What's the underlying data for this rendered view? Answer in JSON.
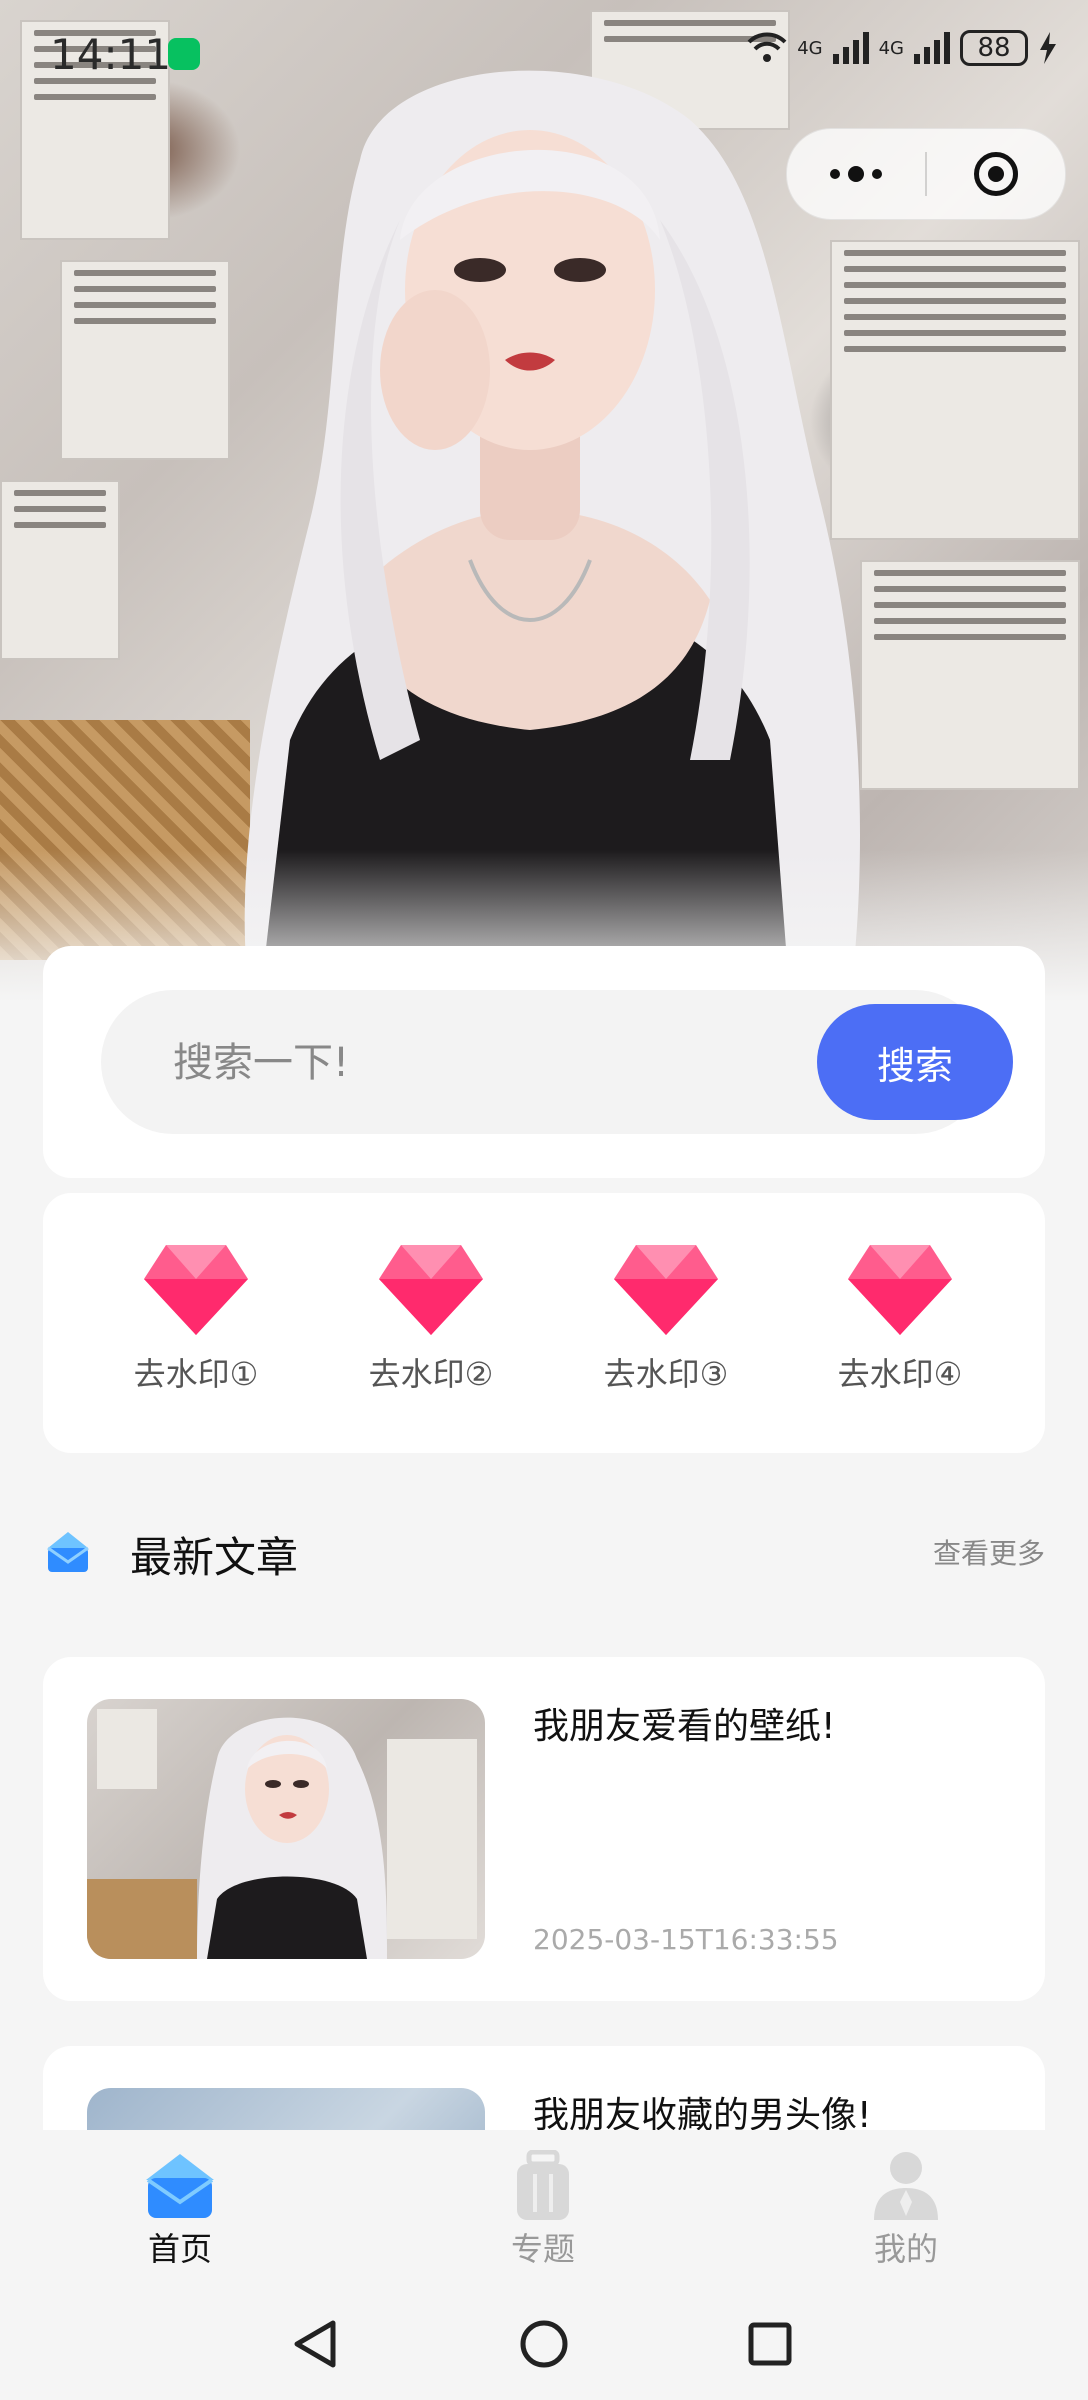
{
  "status_bar": {
    "time": "14:11",
    "network_1": "4G",
    "network_2": "4G",
    "battery": "88"
  },
  "search": {
    "placeholder": "搜索一下!",
    "button_label": "搜索"
  },
  "tools": [
    {
      "label": "去水印①",
      "icon": "diamond-icon"
    },
    {
      "label": "去水印②",
      "icon": "diamond-icon"
    },
    {
      "label": "去水印③",
      "icon": "diamond-icon"
    },
    {
      "label": "去水印④",
      "icon": "diamond-icon"
    }
  ],
  "latest": {
    "title": "最新文章",
    "more_label": "查看更多"
  },
  "articles": [
    {
      "title": "我朋友爱看的壁纸!",
      "date": "2025-03-15T16:33:55"
    },
    {
      "title": "我朋友收藏的男头像!"
    }
  ],
  "tabbar": {
    "items": [
      {
        "label": "首页",
        "icon": "home-icon",
        "active": true
      },
      {
        "label": "专题",
        "icon": "luggage-icon",
        "active": false
      },
      {
        "label": "我的",
        "icon": "user-icon",
        "active": false
      }
    ]
  },
  "colors": {
    "accent": "#4c6ef5",
    "diamond": "#ff3f7a",
    "home_icon": "#2f8cff"
  }
}
